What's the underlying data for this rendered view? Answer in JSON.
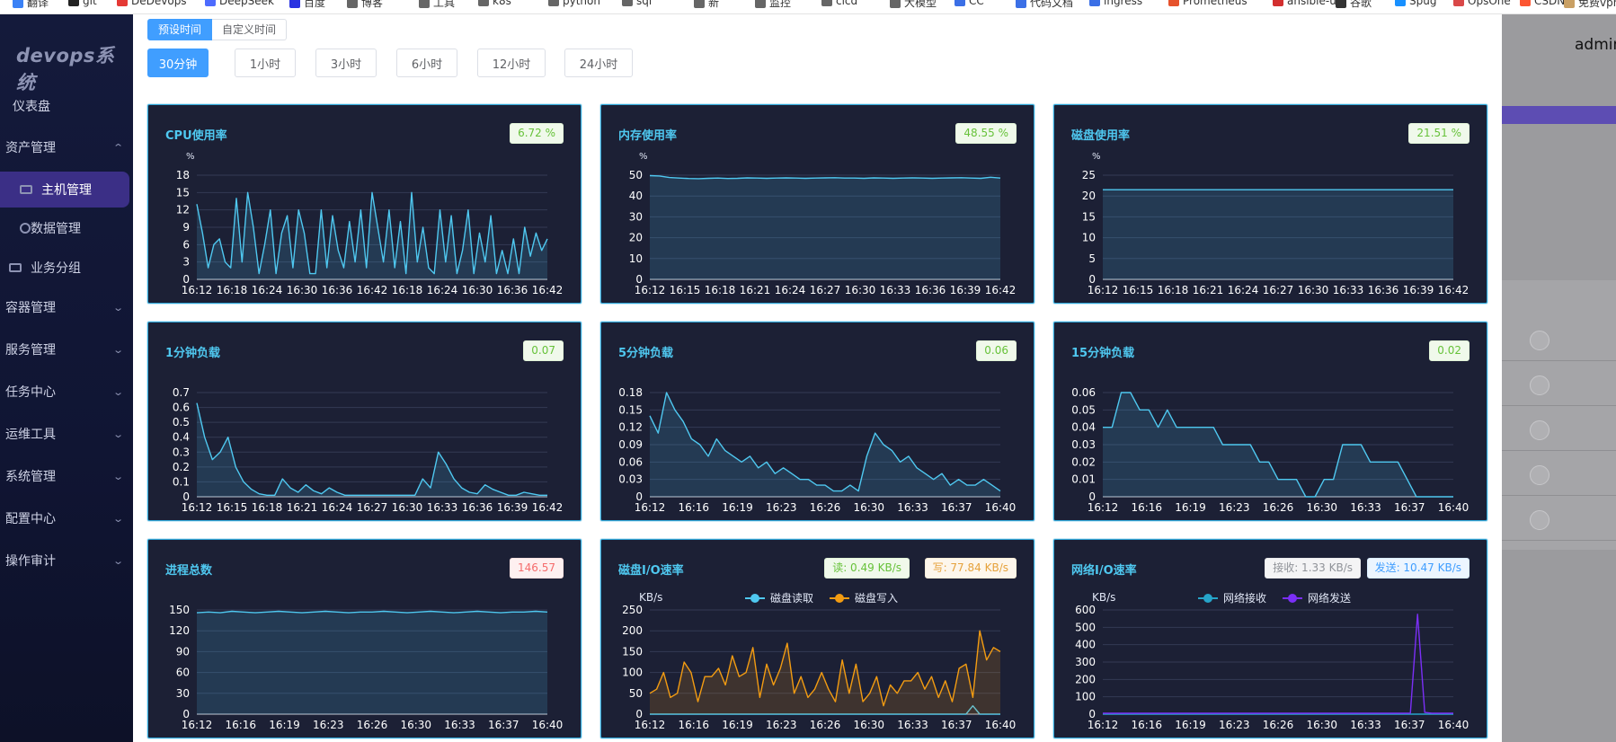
{
  "bookmarks": [
    {
      "label": "翻译",
      "color": "#3b82f6"
    },
    {
      "label": "git",
      "color": "#222222"
    },
    {
      "label": "DeDevops",
      "color": "#e53935"
    },
    {
      "label": "DeepSeek",
      "color": "#4d6bfe"
    },
    {
      "label": "百度",
      "color": "#2932e1"
    },
    {
      "label": "博客",
      "color": "#666666"
    },
    {
      "label": "工具",
      "color": "#666666"
    },
    {
      "label": "k8s",
      "color": "#666666"
    },
    {
      "label": "python",
      "color": "#666666"
    },
    {
      "label": "sql",
      "color": "#666666"
    },
    {
      "label": "新",
      "color": "#666666"
    },
    {
      "label": "监控",
      "color": "#666666"
    },
    {
      "label": "cicd",
      "color": "#666666"
    },
    {
      "label": "大模型",
      "color": "#666666"
    },
    {
      "label": "CC",
      "color": "#3b6fe6"
    },
    {
      "label": "代码文档",
      "color": "#3b6fe6"
    },
    {
      "label": "ingress",
      "color": "#3b6fe6"
    },
    {
      "label": "Prometheus",
      "color": "#e6522c"
    },
    {
      "label": "ansible-ui",
      "color": "#d32f2f"
    },
    {
      "label": "谷歌",
      "color": "#333333"
    },
    {
      "label": "Spug",
      "color": "#1890ff"
    },
    {
      "label": "OpsOne",
      "color": "#d94848"
    },
    {
      "label": "CSDN",
      "color": "#fc5531"
    },
    {
      "label": "免费vpn",
      "color": "#c9a064"
    }
  ],
  "sidebar": {
    "logo": "devops系统",
    "items": [
      {
        "label": "仪表盘",
        "chevron": ""
      },
      {
        "label": "资产管理",
        "chevron": "^"
      },
      {
        "label": "主机管理",
        "chevron": ""
      },
      {
        "label": "数据管理",
        "chevron": ""
      },
      {
        "label": "业务分组",
        "chevron": ""
      },
      {
        "label": "容器管理",
        "chevron": "v"
      },
      {
        "label": "服务管理",
        "chevron": "v"
      },
      {
        "label": "任务中心",
        "chevron": "v"
      },
      {
        "label": "运维工具",
        "chevron": "v"
      },
      {
        "label": "系统管理",
        "chevron": "v"
      },
      {
        "label": "配置中心",
        "chevron": "v"
      },
      {
        "label": "操作审计",
        "chevron": "v"
      }
    ]
  },
  "header": {
    "user": "admin"
  },
  "time_mode": {
    "preset": "预设时间",
    "custom": "自定义时间"
  },
  "ranges": [
    "30分钟",
    "1小时",
    "3小时",
    "6小时",
    "12小时",
    "24小时"
  ],
  "selected_range": "30分钟",
  "colors": {
    "accent": "#409eff",
    "line": "#4fc8f0",
    "orange": "#f39c12",
    "teal": "#26a4c9",
    "purple": "#7b2ff7",
    "card_bg": "#1c2035"
  },
  "chart_data": [
    {
      "type": "area",
      "title": "CPU使用率",
      "badge": "6.72 %",
      "ylabel": "%",
      "ylim": [
        0,
        18
      ],
      "yticks": [
        0,
        3,
        6,
        9,
        12,
        15,
        18
      ],
      "xticks": [
        "16:12",
        "16:18",
        "16:24",
        "16:30",
        "16:36",
        "16:42",
        "16:18",
        "16:24",
        "16:30",
        "16:36",
        "16:42"
      ],
      "series": [
        {
          "values": [
            13,
            8,
            2,
            6,
            7,
            3,
            2,
            14,
            3,
            15,
            9,
            1,
            6,
            12,
            1,
            8,
            11,
            2,
            12,
            8,
            1,
            1,
            12,
            2,
            11,
            5,
            2,
            10,
            3,
            12,
            2,
            15,
            9,
            3,
            12,
            2,
            10,
            1,
            15,
            3,
            9,
            2,
            1,
            12,
            3,
            11,
            1,
            5,
            12,
            1,
            8,
            3,
            11,
            1,
            5,
            1,
            7,
            1,
            9,
            4,
            8,
            5,
            7
          ]
        }
      ]
    },
    {
      "type": "area",
      "title": "内存使用率",
      "badge": "48.55 %",
      "ylabel": "%",
      "ylim": [
        0,
        50
      ],
      "yticks": [
        0,
        10,
        20,
        30,
        40,
        50
      ],
      "xticks": [
        "16:12",
        "16:15",
        "16:18",
        "16:21",
        "16:24",
        "16:27",
        "16:30",
        "16:33",
        "16:36",
        "16:39",
        "16:42"
      ],
      "series": [
        {
          "values": [
            49.8,
            49.6,
            48.9,
            48.6,
            48.4,
            48.3,
            48.5,
            48.6,
            48.4,
            48.5,
            48.7,
            48.6,
            48.5,
            48.6,
            48.7,
            48.6,
            48.5,
            48.6,
            48.7,
            48.8,
            48.6,
            48.6,
            48.5,
            48.7,
            48.6,
            48.5,
            48.6,
            48.7,
            48.6,
            48.5,
            48.6,
            48.7,
            48.8,
            48.6,
            48.5,
            49.0,
            48.6
          ]
        }
      ]
    },
    {
      "type": "area",
      "title": "磁盘使用率",
      "badge": "21.51 %",
      "ylabel": "%",
      "ylim": [
        0,
        25
      ],
      "yticks": [
        0,
        5,
        10,
        15,
        20,
        25
      ],
      "xticks": [
        "16:12",
        "16:15",
        "16:18",
        "16:21",
        "16:24",
        "16:27",
        "16:30",
        "16:33",
        "16:36",
        "16:39",
        "16:42"
      ],
      "series": [
        {
          "values": [
            21.5,
            21.5,
            21.5,
            21.5,
            21.5,
            21.5,
            21.5,
            21.5,
            21.5,
            21.5,
            21.51
          ]
        }
      ]
    },
    {
      "type": "area",
      "title": "1分钟负载",
      "badge": "0.07",
      "ylabel": "",
      "ylim": [
        0,
        0.7
      ],
      "yticks": [
        0,
        0.1,
        0.2,
        0.3,
        0.4,
        0.5,
        0.6,
        0.7
      ],
      "xticks": [
        "16:12",
        "16:15",
        "16:18",
        "16:21",
        "16:24",
        "16:27",
        "16:30",
        "16:33",
        "16:36",
        "16:39",
        "16:42"
      ],
      "series": [
        {
          "values": [
            0.63,
            0.4,
            0.25,
            0.3,
            0.4,
            0.2,
            0.1,
            0.05,
            0.02,
            0.01,
            0.01,
            0.12,
            0.06,
            0.03,
            0.08,
            0.04,
            0.02,
            0.06,
            0.03,
            0.01,
            0.01,
            0.01,
            0.01,
            0.01,
            0.01,
            0.01,
            0.01,
            0.01,
            0.01,
            0.12,
            0.06,
            0.3,
            0.22,
            0.12,
            0.06,
            0.03,
            0.02,
            0.08,
            0.05,
            0.03,
            0.01,
            0.01,
            0.03,
            0.02,
            0.01,
            0.01
          ]
        }
      ]
    },
    {
      "type": "area",
      "title": "5分钟负载",
      "badge": "0.06",
      "ylabel": "",
      "ylim": [
        0,
        0.18
      ],
      "yticks": [
        0,
        0.03,
        0.06,
        0.09,
        0.12,
        0.15,
        0.18
      ],
      "xticks": [
        "16:12",
        "16:16",
        "16:19",
        "16:23",
        "16:26",
        "16:30",
        "16:33",
        "16:37",
        "16:40"
      ],
      "series": [
        {
          "values": [
            0.14,
            0.11,
            0.18,
            0.15,
            0.13,
            0.1,
            0.09,
            0.07,
            0.1,
            0.08,
            0.07,
            0.06,
            0.07,
            0.05,
            0.06,
            0.04,
            0.05,
            0.04,
            0.03,
            0.03,
            0.02,
            0.02,
            0.01,
            0.01,
            0.02,
            0.01,
            0.07,
            0.11,
            0.09,
            0.08,
            0.06,
            0.07,
            0.05,
            0.04,
            0.03,
            0.04,
            0.02,
            0.03,
            0.02,
            0.02,
            0.03,
            0.02,
            0.01
          ]
        }
      ]
    },
    {
      "type": "area",
      "title": "15分钟负载",
      "badge": "0.02",
      "ylabel": "",
      "ylim": [
        0,
        0.06
      ],
      "yticks": [
        0,
        0.01,
        0.02,
        0.03,
        0.04,
        0.05,
        0.06
      ],
      "xticks": [
        "16:12",
        "16:16",
        "16:19",
        "16:23",
        "16:26",
        "16:30",
        "16:33",
        "16:37",
        "16:40"
      ],
      "series": [
        {
          "values": [
            0.04,
            0.04,
            0.06,
            0.06,
            0.05,
            0.05,
            0.04,
            0.05,
            0.04,
            0.04,
            0.04,
            0.04,
            0.04,
            0.03,
            0.03,
            0.03,
            0.03,
            0.02,
            0.02,
            0.01,
            0.01,
            0.01,
            0.0,
            0.0,
            0.01,
            0.01,
            0.03,
            0.03,
            0.03,
            0.02,
            0.02,
            0.02,
            0.02,
            0.01,
            0.0,
            0.0,
            0.0,
            0.0,
            0.0
          ]
        }
      ]
    },
    {
      "type": "area",
      "title": "进程总数",
      "badge": "146.57",
      "ylabel": "",
      "ylim": [
        0,
        150
      ],
      "yticks": [
        0,
        30,
        60,
        90,
        120,
        150
      ],
      "xticks": [
        "16:12",
        "16:16",
        "16:19",
        "16:23",
        "16:26",
        "16:30",
        "16:33",
        "16:37",
        "16:40"
      ],
      "series": [
        {
          "values": [
            146,
            147,
            146,
            148,
            147,
            146,
            147,
            148,
            147,
            146,
            147,
            148,
            147,
            146,
            147,
            147,
            148,
            147,
            146,
            147,
            148,
            147,
            146,
            147,
            148,
            147,
            146,
            147,
            147,
            148,
            147
          ]
        }
      ]
    },
    {
      "type": "line",
      "title": "磁盘I/O速率",
      "badges": [
        "读: 0.49 KB/s",
        "写: 77.84 KB/s"
      ],
      "ylabel": "KB/s",
      "ylim": [
        0,
        250
      ],
      "yticks": [
        0,
        50,
        100,
        150,
        200,
        250
      ],
      "xticks": [
        "16:12",
        "16:16",
        "16:19",
        "16:23",
        "16:26",
        "16:30",
        "16:33",
        "16:37",
        "16:40"
      ],
      "series": [
        {
          "name": "磁盘读取",
          "values": [
            0,
            0,
            0,
            0,
            0,
            0,
            0,
            0,
            0,
            0,
            0,
            0,
            0,
            0,
            0,
            0,
            0,
            0,
            0,
            0,
            0,
            0,
            0,
            0,
            0,
            0,
            0,
            0,
            0,
            0,
            0,
            0,
            0,
            0,
            0,
            0,
            0,
            0,
            0,
            0,
            0,
            0,
            0,
            0,
            0,
            0,
            0,
            20,
            0,
            0,
            0,
            0
          ]
        },
        {
          "name": "磁盘写入",
          "values": [
            50,
            60,
            100,
            40,
            50,
            125,
            100,
            30,
            90,
            90,
            110,
            70,
            140,
            90,
            100,
            160,
            40,
            120,
            70,
            110,
            170,
            50,
            90,
            40,
            60,
            100,
            60,
            30,
            130,
            50,
            120,
            30,
            50,
            90,
            20,
            70,
            50,
            80,
            80,
            100,
            60,
            90,
            40,
            80,
            30,
            110,
            120,
            40,
            200,
            130,
            160,
            150
          ]
        }
      ]
    },
    {
      "type": "line",
      "title": "网络I/O速率",
      "badges": [
        "接收: 1.33 KB/s",
        "发送: 10.47 KB/s"
      ],
      "ylabel": "KB/s",
      "ylim": [
        0,
        600
      ],
      "yticks": [
        0,
        100,
        200,
        300,
        400,
        500,
        600
      ],
      "xticks": [
        "16:12",
        "16:16",
        "16:19",
        "16:23",
        "16:26",
        "16:30",
        "16:33",
        "16:37",
        "16:40"
      ],
      "series": [
        {
          "name": "网络接收",
          "values": [
            0,
            0,
            0,
            0,
            0,
            0,
            0,
            0,
            0,
            0,
            0,
            0,
            0,
            0,
            0,
            0,
            0,
            0,
            0,
            0,
            0,
            0,
            0,
            0,
            0,
            0,
            0,
            0,
            0,
            0,
            0,
            0,
            0,
            0,
            0,
            0,
            0,
            0,
            0,
            0,
            0,
            0,
            0,
            0,
            0,
            0,
            0,
            0,
            0,
            0
          ]
        },
        {
          "name": "网络发送",
          "values": [
            5,
            5,
            5,
            5,
            5,
            5,
            5,
            5,
            5,
            5,
            5,
            5,
            5,
            5,
            5,
            5,
            5,
            5,
            5,
            5,
            5,
            5,
            5,
            5,
            5,
            5,
            5,
            5,
            5,
            5,
            5,
            5,
            5,
            5,
            5,
            5,
            5,
            5,
            5,
            5,
            5,
            5,
            5,
            5,
            575,
            10,
            5,
            5,
            5,
            5
          ]
        }
      ]
    }
  ]
}
